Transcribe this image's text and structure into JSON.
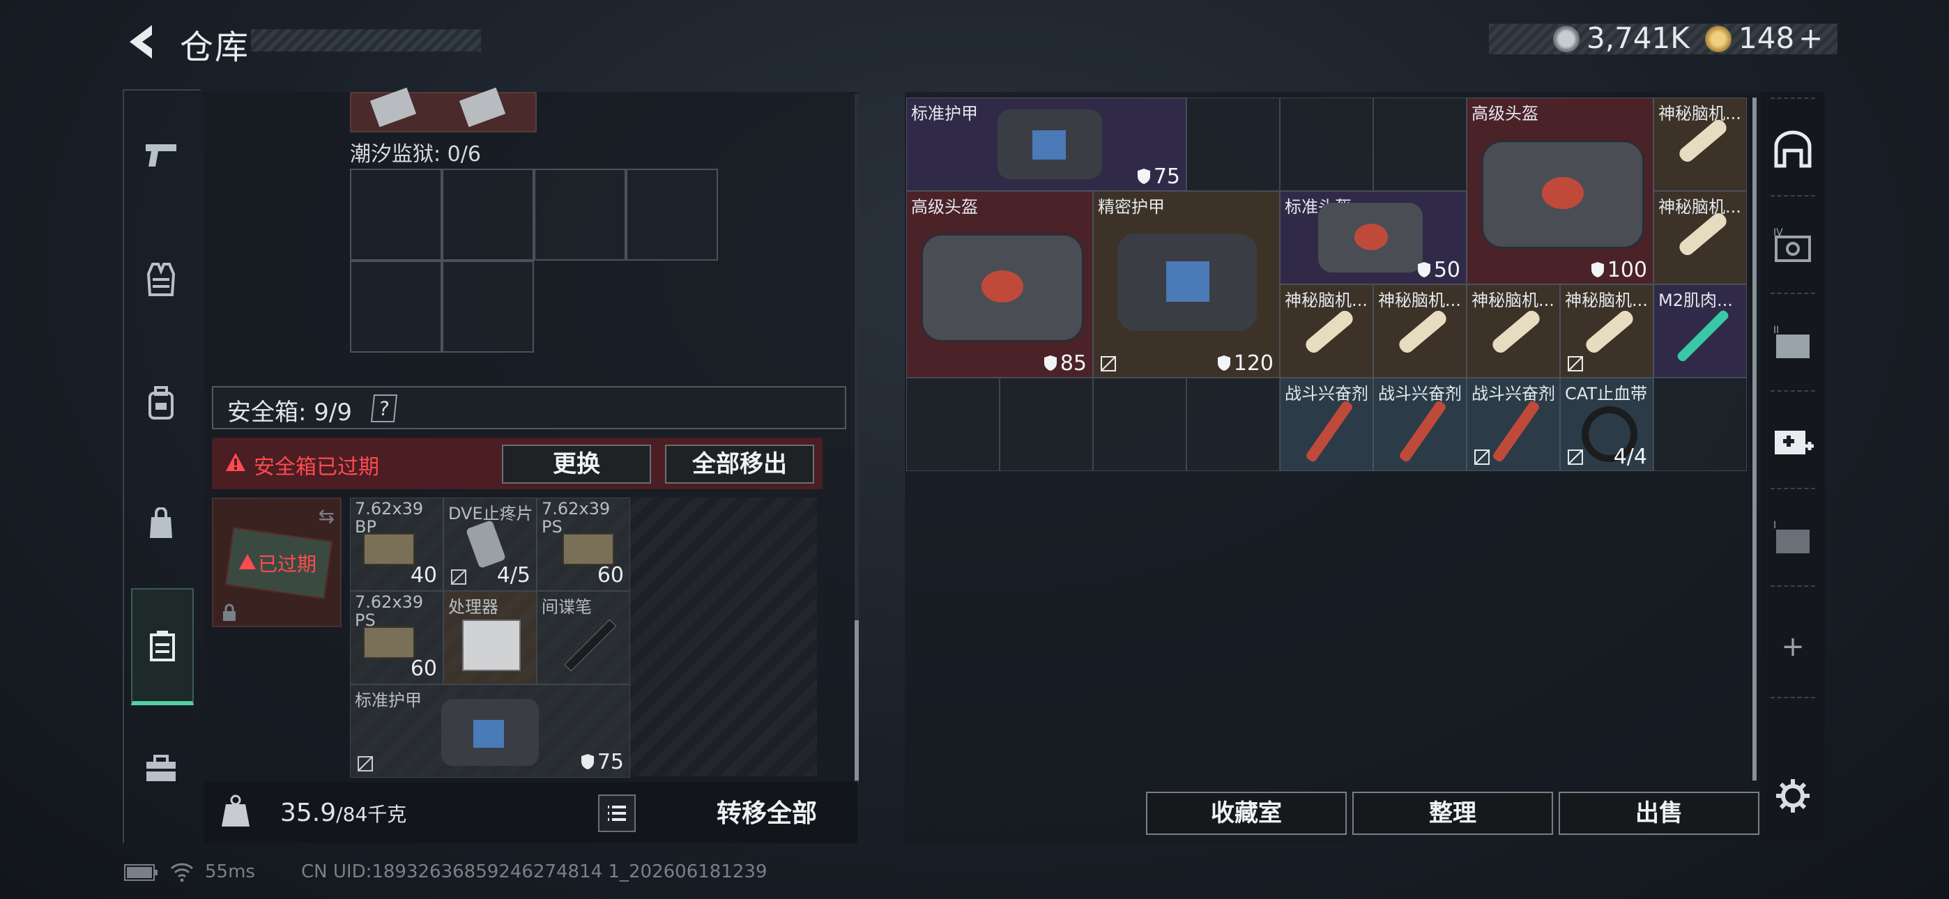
{
  "header": {
    "title": "仓库",
    "currency1_value": "3,741K",
    "currency2_value": "148",
    "currency2_add": "+"
  },
  "left_nav": {
    "items": [
      "pistol-icon",
      "vest-icon",
      "backpack-icon",
      "bag-icon",
      "safe-box-icon",
      "toolbox-icon"
    ],
    "active": "safe-box-icon"
  },
  "left_panel": {
    "prison_label": "潮汐监狱: 0/6",
    "safe_box_label": "安全箱: 9/9",
    "safe_box_help": "?",
    "expired_banner": "安全箱已过期",
    "replace_button": "更换",
    "remove_all_button": "全部移出",
    "safe_slot_status": "已过期",
    "safe_items": [
      {
        "name": "7.62x39 BP",
        "value": "40"
      },
      {
        "name": "DVE止疼片",
        "value": "4/5"
      },
      {
        "name": "7.62x39 PS",
        "value": "60"
      },
      {
        "name": "7.62x39 PS",
        "value": "60"
      },
      {
        "name": "处理器",
        "value": ""
      },
      {
        "name": "间谍笔",
        "value": ""
      },
      {
        "name": "标准护甲",
        "value": "75"
      }
    ],
    "weight_value": "35.9",
    "weight_max": "/84千克",
    "transfer_all_button": "转移全部"
  },
  "right_panel": {
    "items": [
      {
        "name": "标准护甲",
        "value": "75"
      },
      {
        "name": "高级头盔",
        "value": "100"
      },
      {
        "name": "神秘脑机...",
        "value": ""
      },
      {
        "name": "神秘脑机...",
        "value": ""
      },
      {
        "name": "高级头盔",
        "value": "85"
      },
      {
        "name": "精密护甲",
        "value": "120"
      },
      {
        "name": "标准头盔",
        "value": "50"
      },
      {
        "name": "神秘脑机...",
        "value": ""
      },
      {
        "name": "神秘脑机...",
        "value": ""
      },
      {
        "name": "神秘脑机...",
        "value": ""
      },
      {
        "name": "神秘脑机...",
        "value": ""
      },
      {
        "name": "M2肌肉...",
        "value": ""
      },
      {
        "name": "战斗兴奋剂",
        "value": ""
      },
      {
        "name": "战斗兴奋剂",
        "value": ""
      },
      {
        "name": "战斗兴奋剂",
        "value": ""
      },
      {
        "name": "CAT止血带",
        "value": "4/4"
      }
    ],
    "collection_button": "收藏室",
    "sort_button": "整理",
    "sell_button": "出售"
  },
  "right_nav": {
    "add_symbol": "+"
  },
  "footer": {
    "ping": "55ms",
    "uid": "CN UID:18932636859246274814 1_202606181239"
  },
  "colors": {
    "accent_green": "#4fd3a0",
    "warning_red": "#ff4a52",
    "expired_bg": "#4a1e22"
  }
}
